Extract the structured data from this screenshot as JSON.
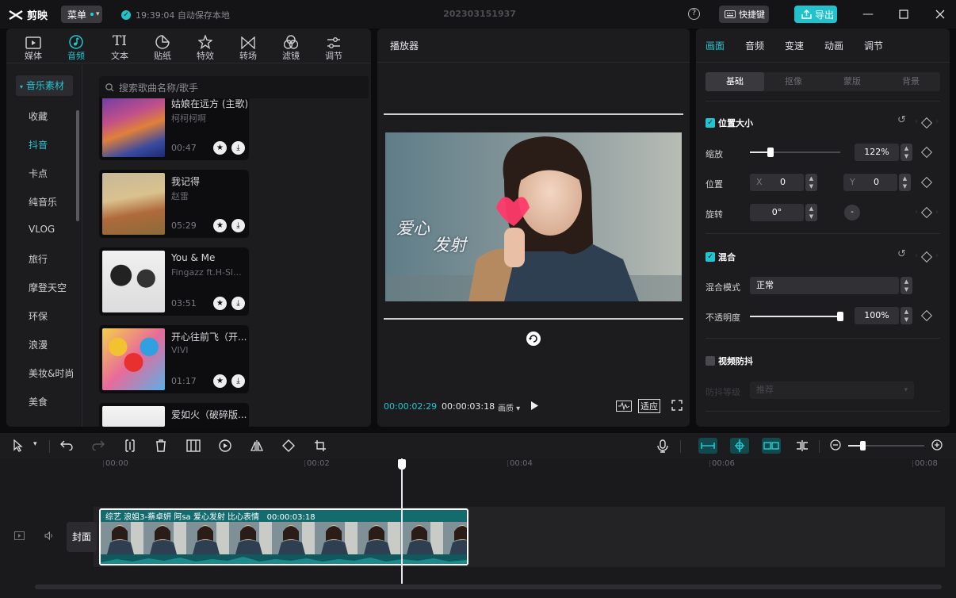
{
  "app": {
    "logo_text": "剪映",
    "menu_label": "菜单",
    "autosave": "19:39:04 自动保存本地",
    "project_title": "202303151937",
    "shortcut_label": "快捷键",
    "export_label": "导出"
  },
  "media": {
    "tabs": [
      {
        "label": "媒体",
        "icon": "media-icon"
      },
      {
        "label": "音频",
        "icon": "audio-icon"
      },
      {
        "label": "文本",
        "icon": "text-icon"
      },
      {
        "label": "贴纸",
        "icon": "sticker-icon"
      },
      {
        "label": "特效",
        "icon": "effects-icon"
      },
      {
        "label": "转场",
        "icon": "transition-icon"
      },
      {
        "label": "滤镜",
        "icon": "filter-icon"
      },
      {
        "label": "调节",
        "icon": "adjust-icon"
      }
    ],
    "active_tab": 1,
    "categories_head": "音乐素材",
    "categories": [
      "收藏",
      "抖音",
      "卡点",
      "纯音乐",
      "VLOG",
      "旅行",
      "摩登天空",
      "环保",
      "浪漫",
      "美妆&时尚",
      "美食"
    ],
    "selected_category": 1,
    "search_placeholder": "搜索歌曲名称/歌手",
    "songs": [
      {
        "title": "姑娘在远方 (主歌)",
        "artist": "柯柯柯啊",
        "duration": "00:47"
      },
      {
        "title": "我记得",
        "artist": "赵雷",
        "duration": "05:29"
      },
      {
        "title": "You & Me",
        "artist": "Fingazz ft.H-Sl...",
        "duration": "03:51"
      },
      {
        "title": "开心往前飞（开...",
        "artist": "VIVI",
        "duration": "01:17"
      },
      {
        "title": "爱如火（破碎版...",
        "artist": "",
        "duration": ""
      }
    ]
  },
  "player": {
    "title": "播放器",
    "current_time": "00:00:02:29",
    "total_time": "00:00:03:18",
    "quality_label": "画质",
    "fit_label": "适应",
    "video_caption_1": "爱心",
    "video_caption_2": "发射"
  },
  "props": {
    "tabs": [
      "画面",
      "音频",
      "变速",
      "动画",
      "调节"
    ],
    "active_tab": 0,
    "subtabs": [
      "基础",
      "抠像",
      "蒙版",
      "背景"
    ],
    "active_subtab": 0,
    "position_size": {
      "title": "位置大小",
      "scale_label": "缩放",
      "scale_value": "122%",
      "scale_fraction": 0.23,
      "position_label": "位置",
      "x_label": "X",
      "x_value": "0",
      "y_label": "Y",
      "y_value": "0",
      "rotate_label": "旋转",
      "rotate_value": "0°"
    },
    "blend": {
      "title": "混合",
      "mode_label": "混合模式",
      "mode_value": "正常",
      "opacity_label": "不透明度",
      "opacity_value": "100%",
      "opacity_fraction": 1.0
    },
    "stabilize": {
      "title": "视频防抖",
      "level_label": "防抖等级",
      "level_value": "推荐"
    }
  },
  "timeline": {
    "ticks": [
      "00:00",
      "00:02",
      "00:04",
      "00:06",
      "00:08"
    ],
    "clip_title": "综艺 浪姐3-蔡卓妍 阿sa 爱心发射 比心表情",
    "clip_duration": "00:00:03:18",
    "cover_label": "封面"
  }
}
